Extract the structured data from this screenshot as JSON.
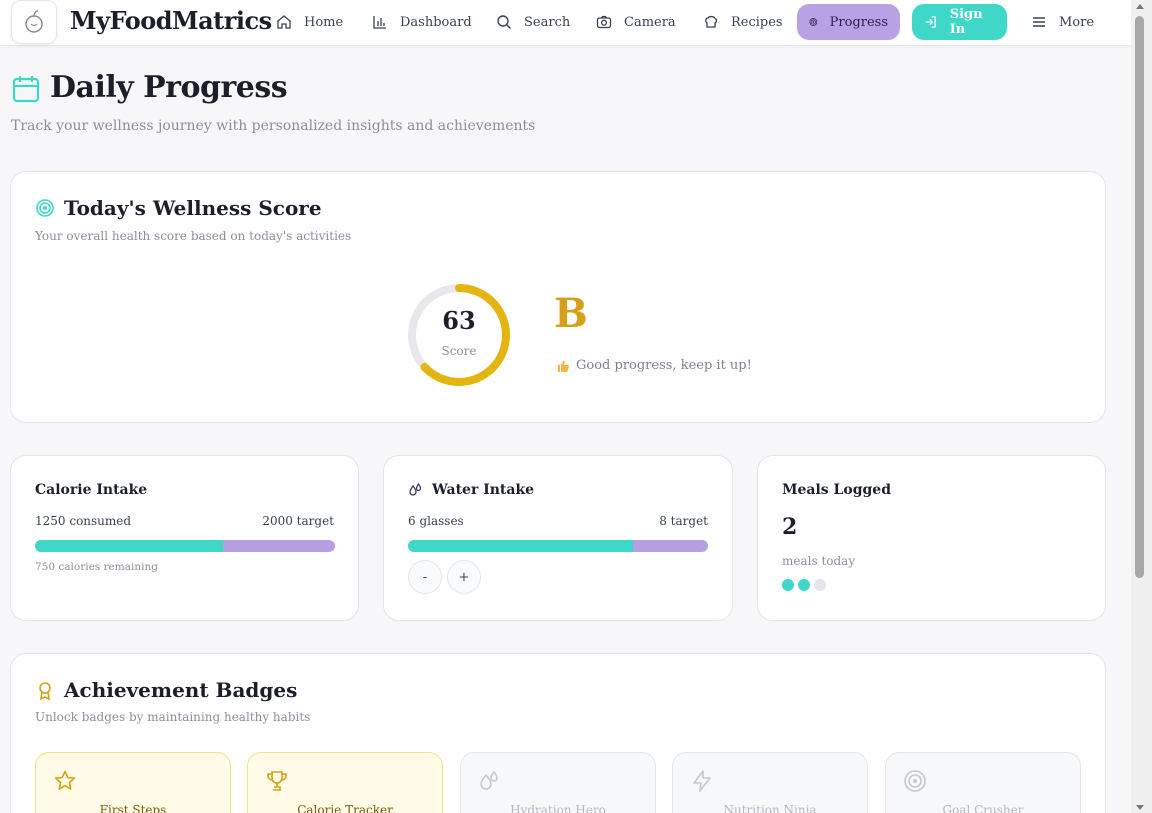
{
  "brand": "MyFoodMatrics",
  "nav": {
    "items": [
      {
        "label": "Home",
        "icon": "home-icon"
      },
      {
        "label": "Dashboard",
        "icon": "bar-chart-icon"
      },
      {
        "label": "Search",
        "icon": "search-icon"
      },
      {
        "label": "Camera",
        "icon": "camera-icon"
      },
      {
        "label": "Recipes",
        "icon": "chef-hat-icon"
      },
      {
        "label": "Progress",
        "icon": "target-icon",
        "active": true
      },
      {
        "label": "Sign In",
        "icon": "sign-in-icon"
      },
      {
        "label": "More",
        "icon": "menu-icon"
      }
    ]
  },
  "header": {
    "title": "Daily Progress",
    "subtitle": "Track your wellness journey with personalized insights and achievements"
  },
  "wellness": {
    "title": "Today's Wellness Score",
    "subtitle": "Your overall health score based on today's activities",
    "score": "63",
    "score_label": "Score",
    "score_fraction": 0.63,
    "grade": "B",
    "message": "Good progress, keep it up!"
  },
  "calories": {
    "title": "Calorie Intake",
    "consumed": "1250 consumed",
    "target": "2000 target",
    "fraction": 0.625,
    "remaining": "750 calories remaining"
  },
  "water": {
    "title": "Water Intake",
    "glasses": "6 glasses",
    "target": "8 target",
    "fraction": 0.75,
    "minus": "-",
    "plus": "+"
  },
  "meals": {
    "title": "Meals Logged",
    "count": "2",
    "label": "meals today",
    "logged": 2,
    "total": 3
  },
  "badges": {
    "title": "Achievement Badges",
    "subtitle": "Unlock badges by maintaining healthy habits",
    "items": [
      {
        "name": "First Steps",
        "icon": "star-icon",
        "earned": true
      },
      {
        "name": "Calorie Tracker",
        "icon": "trophy-icon",
        "earned": true
      },
      {
        "name": "Hydration Hero",
        "icon": "droplets-icon",
        "earned": false
      },
      {
        "name": "Nutrition Ninja",
        "icon": "zap-icon",
        "earned": false
      },
      {
        "name": "Goal Crusher",
        "icon": "target-icon",
        "earned": false
      }
    ]
  },
  "colors": {
    "accent_teal": "#3fd8c8",
    "accent_purple": "#b79fe3",
    "grade_gold": "#d4a017"
  }
}
